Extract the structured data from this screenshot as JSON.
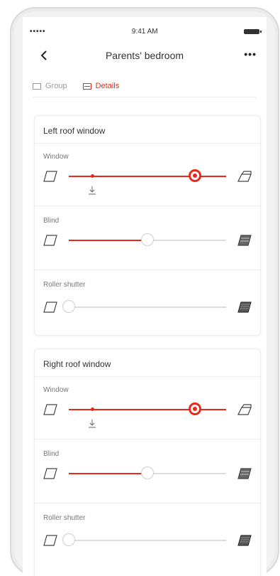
{
  "status_bar": {
    "signal": "•••••",
    "time": "9:41 AM"
  },
  "nav": {
    "title": "Parents' bedroom"
  },
  "tabs": [
    {
      "label": "Group",
      "active": false
    },
    {
      "label": "Details",
      "active": true
    }
  ],
  "accent_color": "#e8291c",
  "cards": [
    {
      "title": "Left roof window",
      "controls": [
        {
          "label": "Window",
          "level": 0.8,
          "marker_level": 0.15,
          "icon_left": "window-closed-icon",
          "icon_right": "window-open-icon"
        },
        {
          "label": "Blind",
          "level": 0.5,
          "icon_left": "window-closed-icon",
          "icon_right": "blind-closed-icon"
        },
        {
          "label": "Roller shutter",
          "level": 0.0,
          "icon_left": "window-closed-icon",
          "icon_right": "shutter-closed-icon"
        }
      ]
    },
    {
      "title": "Right roof window",
      "controls": [
        {
          "label": "Window",
          "level": 0.8,
          "marker_level": 0.15,
          "icon_left": "window-closed-icon",
          "icon_right": "window-open-icon"
        },
        {
          "label": "Blind",
          "level": 0.5,
          "icon_left": "window-closed-icon",
          "icon_right": "blind-closed-icon"
        },
        {
          "label": "Roller shutter",
          "level": 0.0,
          "icon_left": "window-closed-icon",
          "icon_right": "shutter-closed-icon"
        }
      ]
    }
  ]
}
